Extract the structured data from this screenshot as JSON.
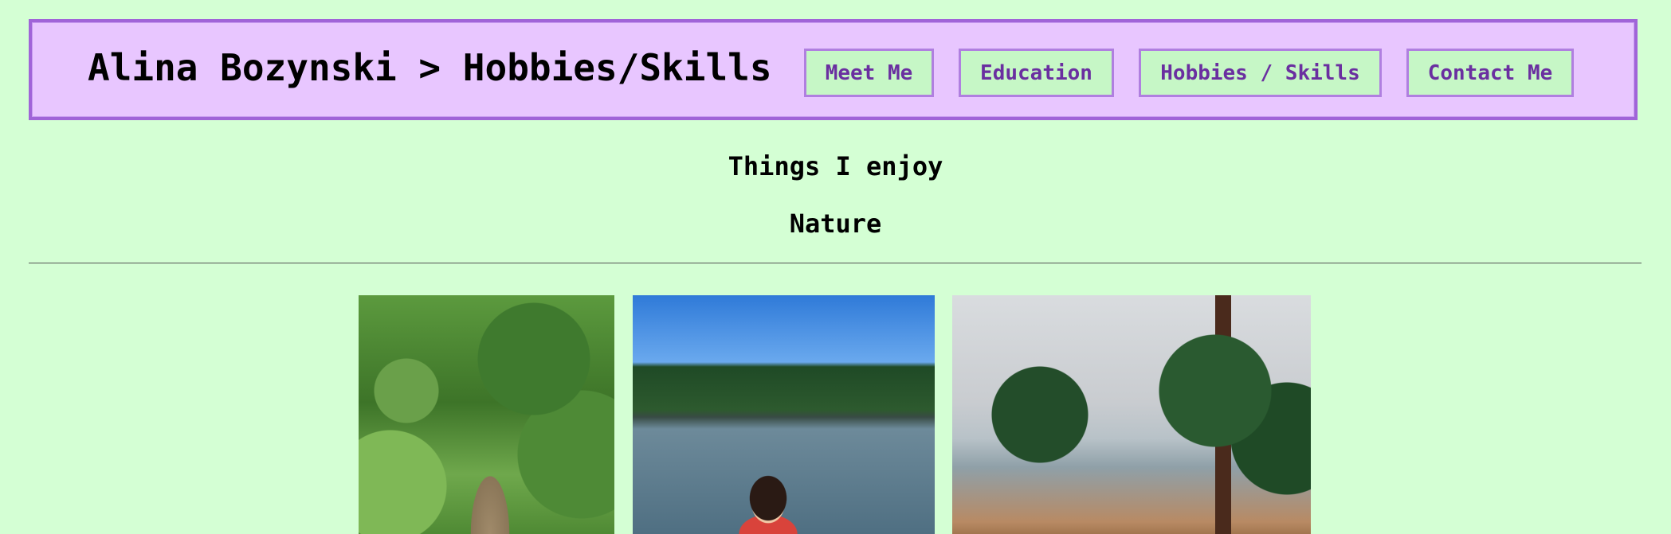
{
  "header": {
    "title": "Alina Bozynski > Hobbies/Skills",
    "nav": [
      {
        "label": "Meet Me"
      },
      {
        "label": "Education"
      },
      {
        "label": "Hobbies / Skills"
      },
      {
        "label": "Contact Me"
      }
    ]
  },
  "main": {
    "heading": "Things I enjoy",
    "subheading": "Nature"
  },
  "colors": {
    "page_background": "#d4ffd4",
    "header_background": "#e8c6ff",
    "header_border": "#a064d8",
    "nav_text": "#6a2fa0",
    "nav_background": "#c6f7c6"
  }
}
